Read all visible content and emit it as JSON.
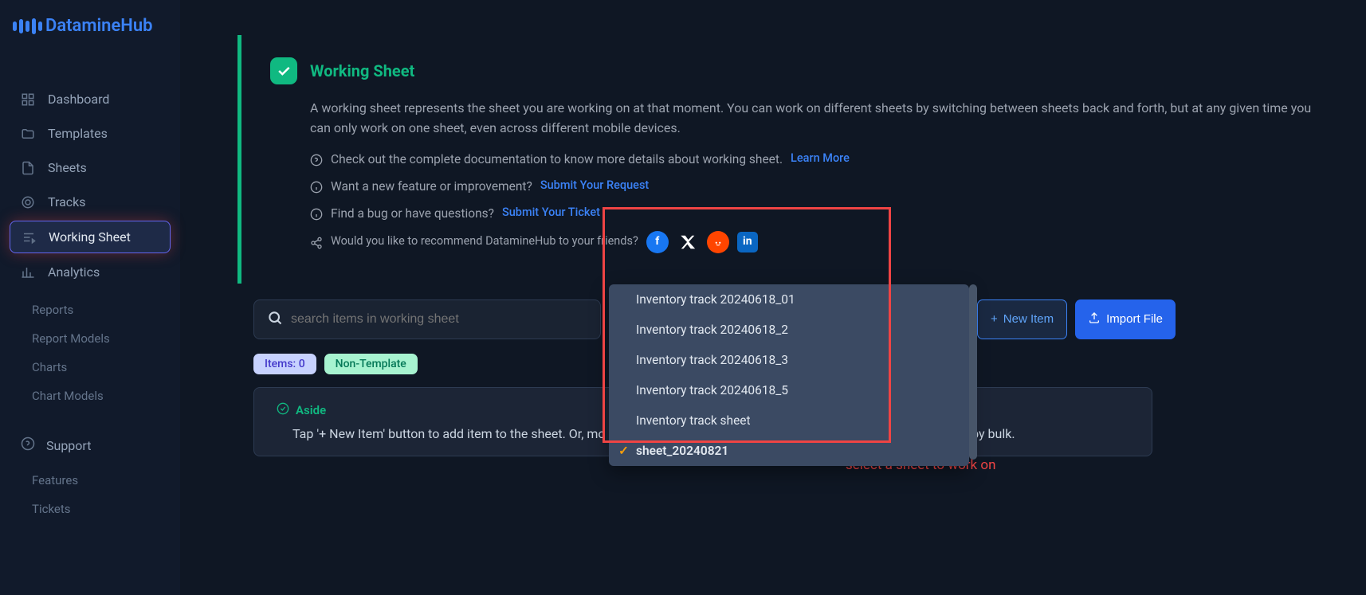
{
  "brand": "DatamineHub",
  "sidebar": {
    "items": [
      {
        "label": "Dashboard"
      },
      {
        "label": "Templates"
      },
      {
        "label": "Sheets"
      },
      {
        "label": "Tracks"
      },
      {
        "label": "Working Sheet"
      },
      {
        "label": "Analytics"
      }
    ],
    "sub": [
      {
        "label": "Reports"
      },
      {
        "label": "Report Models"
      },
      {
        "label": "Charts"
      },
      {
        "label": "Chart Models"
      }
    ],
    "support": "Support",
    "sub2": [
      {
        "label": "Features"
      },
      {
        "label": "Tickets"
      }
    ]
  },
  "info": {
    "title": "Working Sheet",
    "desc": "A working sheet represents the sheet you are working on at that moment. You can work on different sheets by switching between sheets back and forth, but at any given time you can only work on one sheet, even across different mobile devices.",
    "doc_text": "Check out the complete documentation to know more details about working sheet.",
    "learn_more": "Learn More",
    "feature_text": "Want a new feature or improvement?",
    "submit_request": "Submit Your Request",
    "bug_text": "Find a bug or have questions?",
    "submit_ticket": "Submit Your Ticket",
    "recommend_text": "Would you like to recommend DatamineHub to your friends?"
  },
  "controls": {
    "search_placeholder": "search items in working sheet",
    "selected_sheet": "sheet_20240821",
    "new_item": "New Item",
    "import_file": "Import File"
  },
  "badges": {
    "items": "Items: 0",
    "nontemplate": "Non-Template"
  },
  "aside": {
    "title": "Aside",
    "prefix": "Tap '+ New Item' button to add item to the sheet. Or, mo",
    "suffix": "on to import all by bulk."
  },
  "dropdown": {
    "options": [
      "Inventory track 20240618_01",
      "Inventory track 20240618_2",
      "Inventory track 20240618_3",
      "Inventory track 20240618_5",
      "Inventory track sheet",
      "sheet_20240821"
    ]
  },
  "annotation": "select a sheet to work on"
}
